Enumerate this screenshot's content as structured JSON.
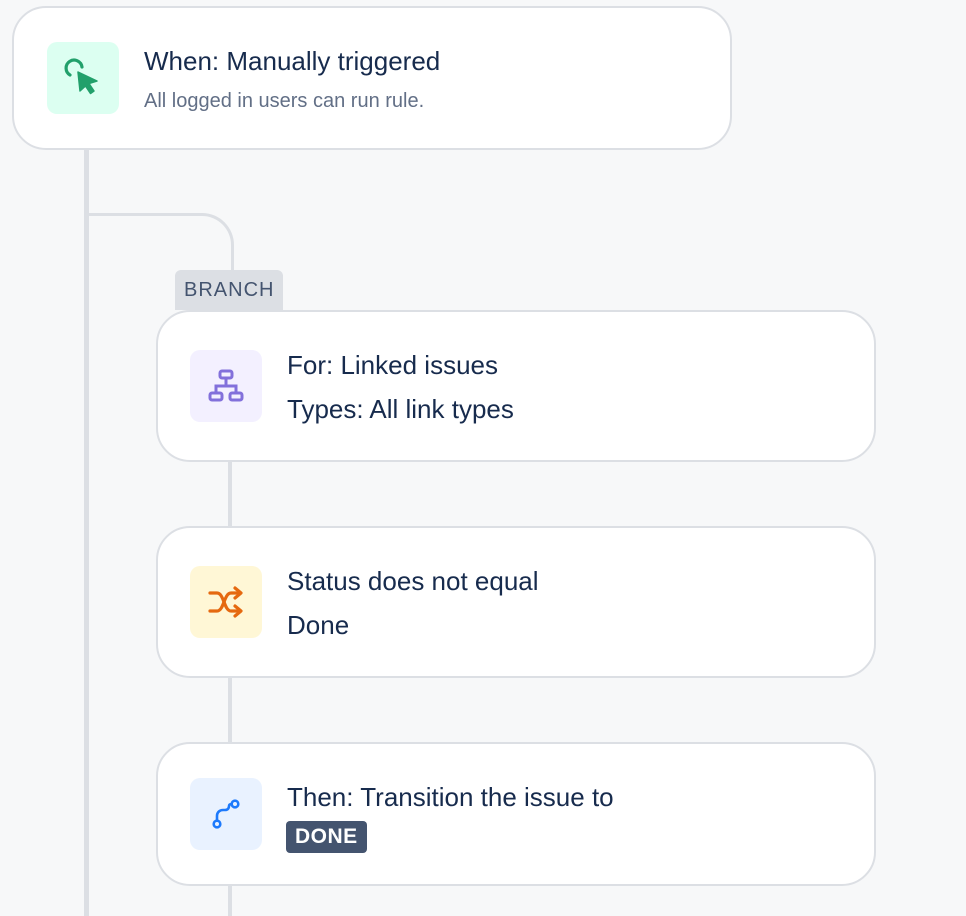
{
  "trigger": {
    "title": "When: Manually triggered",
    "subtitle": "All logged in users can run rule.",
    "icon": "cursor-click-icon",
    "icon_color": "#22a06b"
  },
  "branch": {
    "label": "BRANCH",
    "title": "For: Linked issues",
    "subtitle": "Types: All link types",
    "icon": "hierarchy-icon",
    "icon_color": "#8270db"
  },
  "condition": {
    "title": "Status does not equal",
    "subtitle": "Done",
    "icon": "shuffle-icon",
    "icon_color": "#e56910"
  },
  "action": {
    "title": "Then: Transition the issue to",
    "status": "DONE",
    "icon": "transition-path-icon",
    "icon_color": "#1d7afc"
  }
}
